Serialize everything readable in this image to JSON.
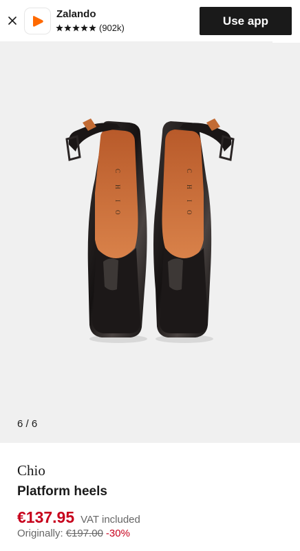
{
  "banner": {
    "app_name": "Zalando",
    "rating_stars": 5,
    "rating_count": "(902k)",
    "cta_label": "Use app",
    "logo_color": "#ff6900"
  },
  "gallery": {
    "counter": "6 / 6",
    "background": "#f0f0f0"
  },
  "product": {
    "brand": "Chio",
    "name": "Platform heels",
    "price": "€137.95",
    "vat_note": "VAT included",
    "original_label": "Originally:",
    "original_price": "€197.00",
    "discount": "-30%",
    "price_color": "#c7001c"
  }
}
